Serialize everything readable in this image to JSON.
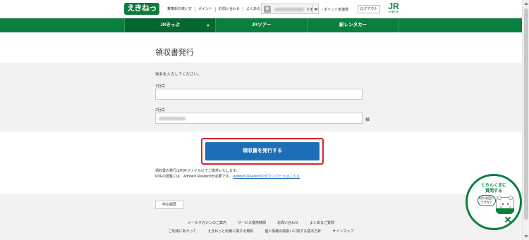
{
  "header": {
    "logo_text": "えきねっと",
    "util_links": [
      "乗車駅の使い方",
      "ポイント",
      "お問い合わせ",
      "よくあるご質問"
    ],
    "user_suffix": "さま",
    "points_label": "ポイント未連携",
    "logout_label": "ログアウト",
    "jr_mark": "JR",
    "jr_sub": "JR東日本"
  },
  "nav": {
    "tabs": [
      {
        "label": "JRきっぷ"
      },
      {
        "label": "JRツアー"
      },
      {
        "label": "駅レンタカー"
      }
    ]
  },
  "main": {
    "title": "領収書発行",
    "instruction": "宛名を入力してください。",
    "line1_label": "1行目",
    "line1_value": "",
    "line2_label": "2行目",
    "line2_suffix": "様",
    "issue_button": "領収書を発行する",
    "note1": "領収書の発行はPDFファイルにてご提供いたします。",
    "note2_prefix": "PDFの閲覧には、Adobe® Reader®が必要です。",
    "note2_link": "Adobe® Reader®のダウンロードはこちら"
  },
  "footer": {
    "back_button": "申込履歴",
    "row1": [
      "メールマガジンのご案内",
      "サービス提供時間",
      "お問い合わせ",
      "よくあるご質問"
    ],
    "row2": [
      "ご利用にあたって",
      "えきねっと利用に関する規約",
      "個人情報の取扱いに関する基本方針",
      "サイトマップ"
    ]
  },
  "chat": {
    "title_line1": "とらんくまに",
    "title_line2": "質問する",
    "bubble_line1": "何かお困り",
    "bubble_line2": "ですか？"
  }
}
